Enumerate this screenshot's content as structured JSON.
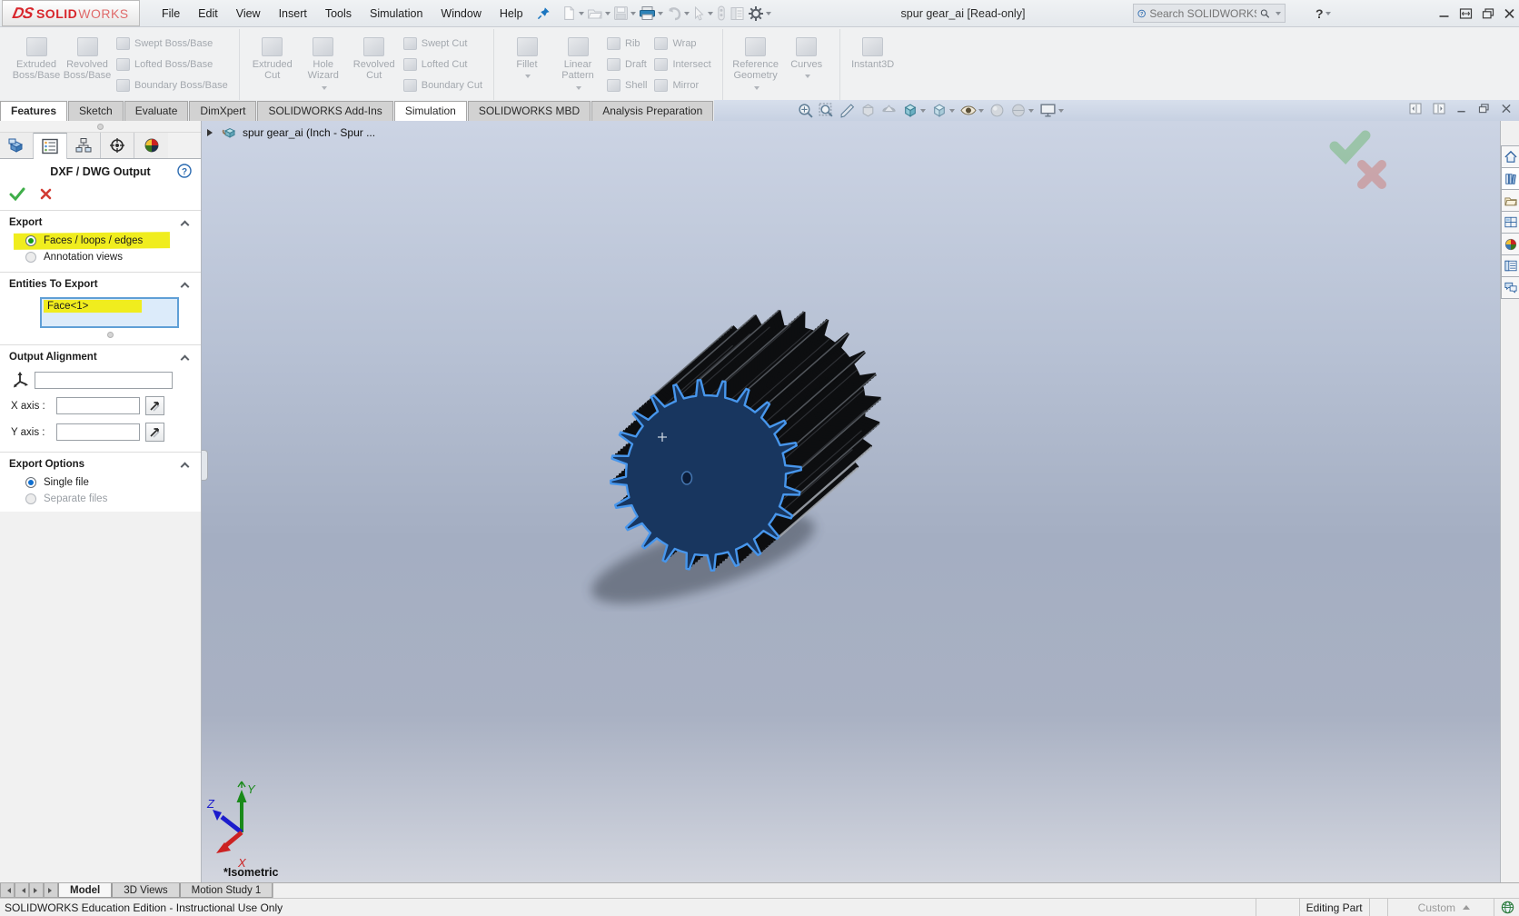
{
  "title_bar": {
    "logo": {
      "ds": "DS",
      "brand_bold": "SOLID",
      "brand_light": "WORKS"
    },
    "menus": [
      "File",
      "Edit",
      "View",
      "Insert",
      "Tools",
      "Simulation",
      "Window",
      "Help"
    ],
    "document_title": "spur gear_ai [Read-only]",
    "search_placeholder": "Search SOLIDWORKS Help",
    "help_glyph": "?"
  },
  "ribbon": {
    "groups": [
      {
        "large": [
          "Extruded Boss/Base",
          "Revolved Boss/Base"
        ],
        "small": [
          "Swept Boss/Base",
          "Lofted Boss/Base",
          "Boundary Boss/Base"
        ]
      },
      {
        "large": [
          "Extruded Cut",
          "Hole Wizard",
          "Revolved Cut"
        ],
        "small": [
          "Swept Cut",
          "Lofted Cut",
          "Boundary Cut"
        ]
      },
      {
        "large": [
          "Fillet",
          "Linear Pattern"
        ],
        "small": [
          "Rib",
          "Draft",
          "Shell"
        ],
        "small2": [
          "Wrap",
          "Intersect",
          "Mirror"
        ]
      },
      {
        "large": [
          "Reference Geometry",
          "Curves"
        ]
      },
      {
        "large": [
          "Instant3D"
        ]
      }
    ]
  },
  "command_tabs": [
    {
      "label": "Features",
      "state": "active"
    },
    {
      "label": "Sketch",
      "state": ""
    },
    {
      "label": "Evaluate",
      "state": ""
    },
    {
      "label": "DimXpert",
      "state": ""
    },
    {
      "label": "SOLIDWORKS Add-Ins",
      "state": ""
    },
    {
      "label": "Simulation",
      "state": "selected"
    },
    {
      "label": "SOLIDWORKS MBD",
      "state": ""
    },
    {
      "label": "Analysis Preparation",
      "state": ""
    }
  ],
  "property_panel": {
    "title": "DXF / DWG Output",
    "help_glyph": "?",
    "export_section": {
      "header": "Export",
      "radio_faces": "Faces / loops / edges",
      "radio_annotation": "Annotation views"
    },
    "entities_section": {
      "header": "Entities To Export",
      "items": [
        "Face<1>"
      ]
    },
    "alignment_section": {
      "header": "Output Alignment",
      "origin_value": "",
      "x_label": "X axis :",
      "x_value": "",
      "y_label": "Y axis :",
      "y_value": ""
    },
    "options_section": {
      "header": "Export Options",
      "radio_single": "Single file",
      "radio_separate": "Separate files"
    }
  },
  "viewport": {
    "flyout_tree_label": "spur gear_ai  (Inch - Spur ...",
    "view_orientation_label": "*Isometric",
    "triad": {
      "x": "X",
      "y": "Y",
      "z": "Z"
    },
    "gear": {
      "teeth": 24,
      "face_color": "#18365f",
      "outline_color": "#4796ec",
      "body_color": "#0d0e10",
      "shadow_color": "#2f3540"
    }
  },
  "bottom_tabs": [
    {
      "label": "Model",
      "state": "active"
    },
    {
      "label": "3D Views",
      "state": ""
    },
    {
      "label": "Motion Study 1",
      "state": ""
    }
  ],
  "status_bar": {
    "left_text": "SOLIDWORKS Education Edition - Instructional Use Only",
    "mode": "Editing Part",
    "units": "Custom"
  },
  "colors": {
    "highlight_yellow": "#f0ed1e",
    "selection_navy": "#18365f",
    "selection_outline": "#4796ec",
    "confirm_green": "#3fae49",
    "cancel_red": "#d23b33"
  }
}
